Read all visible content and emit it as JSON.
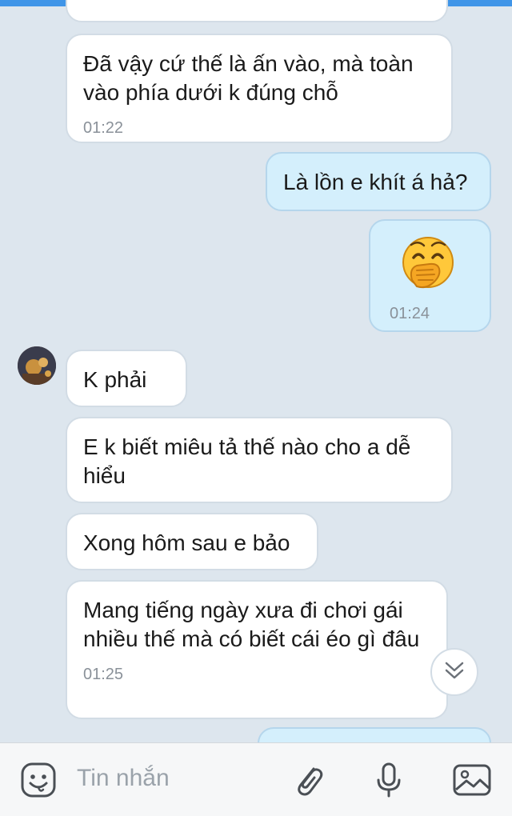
{
  "messages": [
    {
      "side": "in",
      "text": "",
      "time": ""
    },
    {
      "side": "in",
      "text": "Đã vậy cứ thế là ấn vào, mà toàn vào phía dưới k đúng chỗ",
      "time": "01:22"
    },
    {
      "side": "out",
      "text": "Là lồn e khít á hả?",
      "time": ""
    },
    {
      "side": "out",
      "text": "",
      "emoji": "🤭",
      "time": "01:24"
    },
    {
      "side": "in",
      "text": "K phải",
      "time": ""
    },
    {
      "side": "in",
      "text": "E k biết miêu tả thế nào cho a dễ hiểu",
      "time": ""
    },
    {
      "side": "in",
      "text": "Xong hôm sau e bảo",
      "time": ""
    },
    {
      "side": "in",
      "text": "Mang tiếng ngày xưa đi chơi gái nhiều thế mà có biết cái éo gì đâu",
      "time": "01:25"
    }
  ],
  "composer": {
    "placeholder": "Tin nhắn",
    "icons": [
      "emoji-icon",
      "attachment-icon",
      "microphone-icon",
      "image-icon"
    ]
  },
  "scroll_button": {
    "icon": "double-chevron-down-icon"
  },
  "colors": {
    "background": "#dde6ee",
    "incoming_bubble": "#ffffff",
    "outgoing_bubble": "#d4effc",
    "timestamp": "#8a9199",
    "placeholder": "#9aa2aa"
  }
}
